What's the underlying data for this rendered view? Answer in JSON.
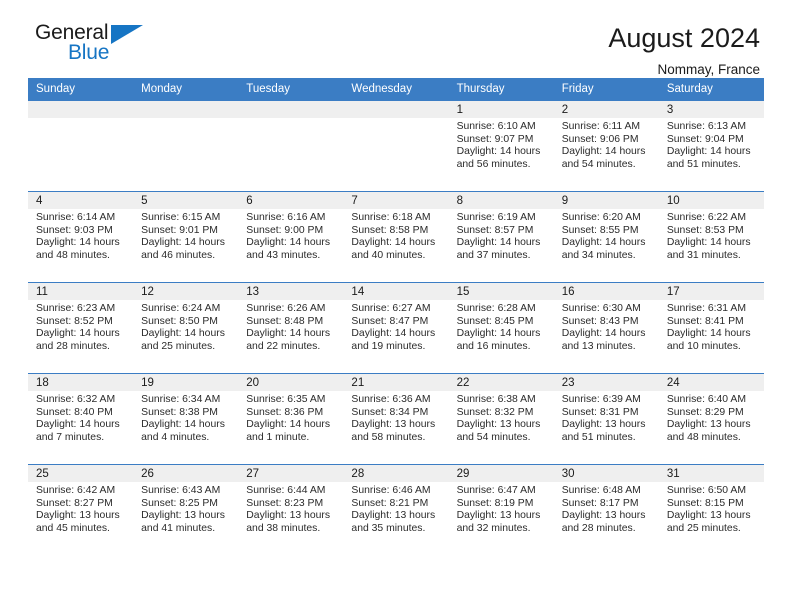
{
  "brand": {
    "name_part1": "General",
    "name_part2": "Blue",
    "triangle_icon": "triangle-icon",
    "accent_color": "#1675c4"
  },
  "header": {
    "title": "August 2024",
    "location": "Nommay, France",
    "header_bg_color": "#3b7dc4",
    "daynum_bg_color": "#efefef"
  },
  "weekdays": [
    "Sunday",
    "Monday",
    "Tuesday",
    "Wednesday",
    "Thursday",
    "Friday",
    "Saturday"
  ],
  "labels": {
    "sunrise": "Sunrise:",
    "sunset": "Sunset:",
    "daylight": "Daylight:"
  },
  "weeks": [
    [
      {
        "day": "",
        "empty": true
      },
      {
        "day": "",
        "empty": true
      },
      {
        "day": "",
        "empty": true
      },
      {
        "day": "",
        "empty": true
      },
      {
        "day": "1",
        "sunrise": "Sunrise: 6:10 AM",
        "sunset": "Sunset: 9:07 PM",
        "daylight": "Daylight: 14 hours and 56 minutes."
      },
      {
        "day": "2",
        "sunrise": "Sunrise: 6:11 AM",
        "sunset": "Sunset: 9:06 PM",
        "daylight": "Daylight: 14 hours and 54 minutes."
      },
      {
        "day": "3",
        "sunrise": "Sunrise: 6:13 AM",
        "sunset": "Sunset: 9:04 PM",
        "daylight": "Daylight: 14 hours and 51 minutes."
      }
    ],
    [
      {
        "day": "4",
        "sunrise": "Sunrise: 6:14 AM",
        "sunset": "Sunset: 9:03 PM",
        "daylight": "Daylight: 14 hours and 48 minutes."
      },
      {
        "day": "5",
        "sunrise": "Sunrise: 6:15 AM",
        "sunset": "Sunset: 9:01 PM",
        "daylight": "Daylight: 14 hours and 46 minutes."
      },
      {
        "day": "6",
        "sunrise": "Sunrise: 6:16 AM",
        "sunset": "Sunset: 9:00 PM",
        "daylight": "Daylight: 14 hours and 43 minutes."
      },
      {
        "day": "7",
        "sunrise": "Sunrise: 6:18 AM",
        "sunset": "Sunset: 8:58 PM",
        "daylight": "Daylight: 14 hours and 40 minutes."
      },
      {
        "day": "8",
        "sunrise": "Sunrise: 6:19 AM",
        "sunset": "Sunset: 8:57 PM",
        "daylight": "Daylight: 14 hours and 37 minutes."
      },
      {
        "day": "9",
        "sunrise": "Sunrise: 6:20 AM",
        "sunset": "Sunset: 8:55 PM",
        "daylight": "Daylight: 14 hours and 34 minutes."
      },
      {
        "day": "10",
        "sunrise": "Sunrise: 6:22 AM",
        "sunset": "Sunset: 8:53 PM",
        "daylight": "Daylight: 14 hours and 31 minutes."
      }
    ],
    [
      {
        "day": "11",
        "sunrise": "Sunrise: 6:23 AM",
        "sunset": "Sunset: 8:52 PM",
        "daylight": "Daylight: 14 hours and 28 minutes."
      },
      {
        "day": "12",
        "sunrise": "Sunrise: 6:24 AM",
        "sunset": "Sunset: 8:50 PM",
        "daylight": "Daylight: 14 hours and 25 minutes."
      },
      {
        "day": "13",
        "sunrise": "Sunrise: 6:26 AM",
        "sunset": "Sunset: 8:48 PM",
        "daylight": "Daylight: 14 hours and 22 minutes."
      },
      {
        "day": "14",
        "sunrise": "Sunrise: 6:27 AM",
        "sunset": "Sunset: 8:47 PM",
        "daylight": "Daylight: 14 hours and 19 minutes."
      },
      {
        "day": "15",
        "sunrise": "Sunrise: 6:28 AM",
        "sunset": "Sunset: 8:45 PM",
        "daylight": "Daylight: 14 hours and 16 minutes."
      },
      {
        "day": "16",
        "sunrise": "Sunrise: 6:30 AM",
        "sunset": "Sunset: 8:43 PM",
        "daylight": "Daylight: 14 hours and 13 minutes."
      },
      {
        "day": "17",
        "sunrise": "Sunrise: 6:31 AM",
        "sunset": "Sunset: 8:41 PM",
        "daylight": "Daylight: 14 hours and 10 minutes."
      }
    ],
    [
      {
        "day": "18",
        "sunrise": "Sunrise: 6:32 AM",
        "sunset": "Sunset: 8:40 PM",
        "daylight": "Daylight: 14 hours and 7 minutes."
      },
      {
        "day": "19",
        "sunrise": "Sunrise: 6:34 AM",
        "sunset": "Sunset: 8:38 PM",
        "daylight": "Daylight: 14 hours and 4 minutes."
      },
      {
        "day": "20",
        "sunrise": "Sunrise: 6:35 AM",
        "sunset": "Sunset: 8:36 PM",
        "daylight": "Daylight: 14 hours and 1 minute."
      },
      {
        "day": "21",
        "sunrise": "Sunrise: 6:36 AM",
        "sunset": "Sunset: 8:34 PM",
        "daylight": "Daylight: 13 hours and 58 minutes."
      },
      {
        "day": "22",
        "sunrise": "Sunrise: 6:38 AM",
        "sunset": "Sunset: 8:32 PM",
        "daylight": "Daylight: 13 hours and 54 minutes."
      },
      {
        "day": "23",
        "sunrise": "Sunrise: 6:39 AM",
        "sunset": "Sunset: 8:31 PM",
        "daylight": "Daylight: 13 hours and 51 minutes."
      },
      {
        "day": "24",
        "sunrise": "Sunrise: 6:40 AM",
        "sunset": "Sunset: 8:29 PM",
        "daylight": "Daylight: 13 hours and 48 minutes."
      }
    ],
    [
      {
        "day": "25",
        "sunrise": "Sunrise: 6:42 AM",
        "sunset": "Sunset: 8:27 PM",
        "daylight": "Daylight: 13 hours and 45 minutes."
      },
      {
        "day": "26",
        "sunrise": "Sunrise: 6:43 AM",
        "sunset": "Sunset: 8:25 PM",
        "daylight": "Daylight: 13 hours and 41 minutes."
      },
      {
        "day": "27",
        "sunrise": "Sunrise: 6:44 AM",
        "sunset": "Sunset: 8:23 PM",
        "daylight": "Daylight: 13 hours and 38 minutes."
      },
      {
        "day": "28",
        "sunrise": "Sunrise: 6:46 AM",
        "sunset": "Sunset: 8:21 PM",
        "daylight": "Daylight: 13 hours and 35 minutes."
      },
      {
        "day": "29",
        "sunrise": "Sunrise: 6:47 AM",
        "sunset": "Sunset: 8:19 PM",
        "daylight": "Daylight: 13 hours and 32 minutes."
      },
      {
        "day": "30",
        "sunrise": "Sunrise: 6:48 AM",
        "sunset": "Sunset: 8:17 PM",
        "daylight": "Daylight: 13 hours and 28 minutes."
      },
      {
        "day": "31",
        "sunrise": "Sunrise: 6:50 AM",
        "sunset": "Sunset: 8:15 PM",
        "daylight": "Daylight: 13 hours and 25 minutes."
      }
    ]
  ]
}
